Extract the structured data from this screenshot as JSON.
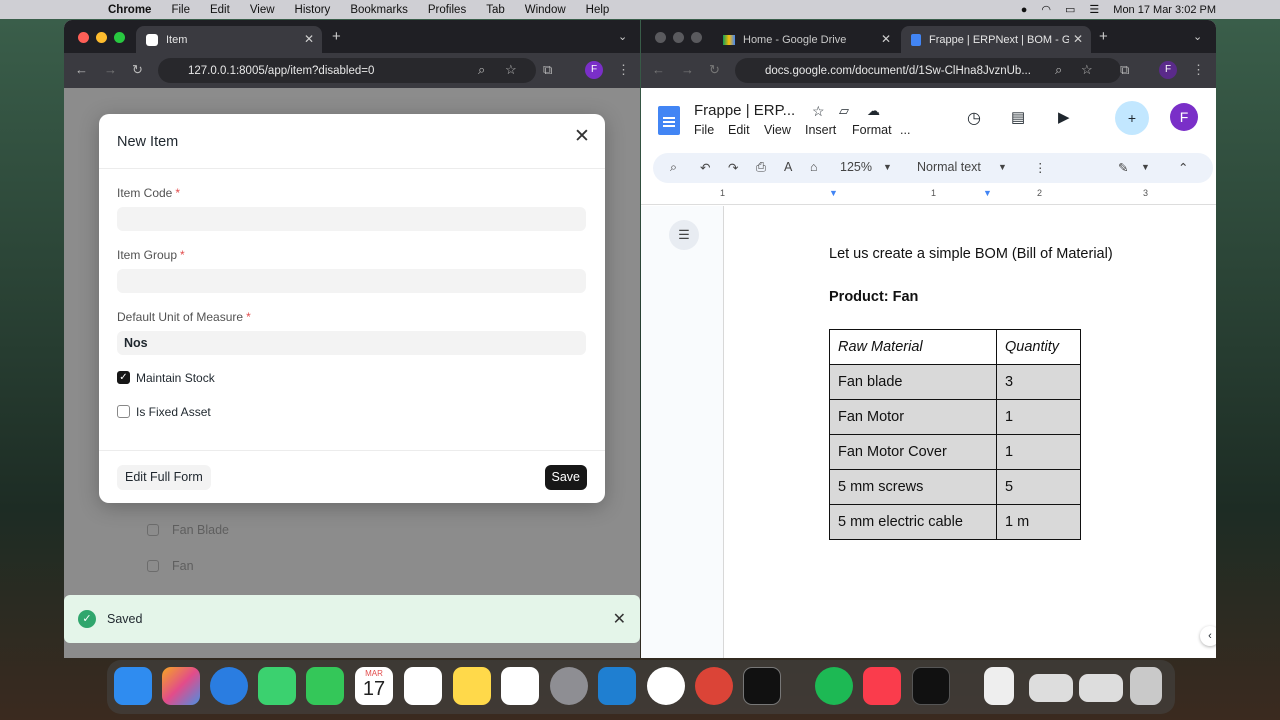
{
  "menubar": {
    "app": "Chrome",
    "items": [
      "File",
      "Edit",
      "View",
      "History",
      "Bookmarks",
      "Profiles",
      "Tab",
      "Window",
      "Help"
    ],
    "clock": "Mon 17 Mar  3:02 PM"
  },
  "left_window": {
    "tab_title": "Item",
    "url": "127.0.0.1:8005/app/item?disabled=0",
    "profile_initial": "F",
    "background_list": [
      "Fan Blade",
      "Fan"
    ],
    "modal": {
      "title": "New Item",
      "fields": [
        {
          "label": "Item Code",
          "value": "",
          "required": true
        },
        {
          "label": "Item Group",
          "value": "",
          "required": true
        },
        {
          "label": "Default Unit of Measure",
          "value": "Nos",
          "required": true
        }
      ],
      "checkboxes": [
        {
          "label": "Maintain Stock",
          "checked": true
        },
        {
          "label": "Is Fixed Asset",
          "checked": false
        }
      ],
      "edit_full_form_label": "Edit Full Form",
      "save_label": "Save"
    },
    "toast": {
      "message": "Saved"
    }
  },
  "right_window": {
    "tabs": [
      {
        "title": "Home - Google Drive",
        "active": false
      },
      {
        "title": "Frappe | ERPNext | BOM - Go",
        "active": true
      }
    ],
    "url": "docs.google.com/document/d/1Sw-ClHna8JvznUb...",
    "profile_initial": "F",
    "doc_title": "Frappe | ERP...",
    "doc_menu": [
      "File",
      "Edit",
      "View",
      "Insert",
      "Format",
      "..."
    ],
    "zoom": "125%",
    "style": "Normal text",
    "ruler_marks": [
      "1",
      "1",
      "2",
      "3"
    ],
    "doc": {
      "line1": "Let us create a simple BOM (Bill of Material)",
      "line2": "Product: Fan",
      "table_headers": [
        "Raw Material",
        "Quantity"
      ],
      "table_rows": [
        [
          "Fan blade",
          "3"
        ],
        [
          "Fan Motor",
          "1"
        ],
        [
          "Fan Motor Cover",
          "1"
        ],
        [
          "5 mm screws",
          "5"
        ],
        [
          "5 mm electric cable",
          "1 m"
        ]
      ]
    }
  },
  "dock": {
    "calendar_month": "MAR",
    "calendar_day": "17",
    "colors": {
      "finder": "#2f8cf0",
      "messages": "#3bd16f",
      "facetime": "#34c759",
      "chrome": "#db4437",
      "spotify": "#1db954",
      "music": "#fa3c4c",
      "vscode": "#1f7fd1"
    }
  }
}
